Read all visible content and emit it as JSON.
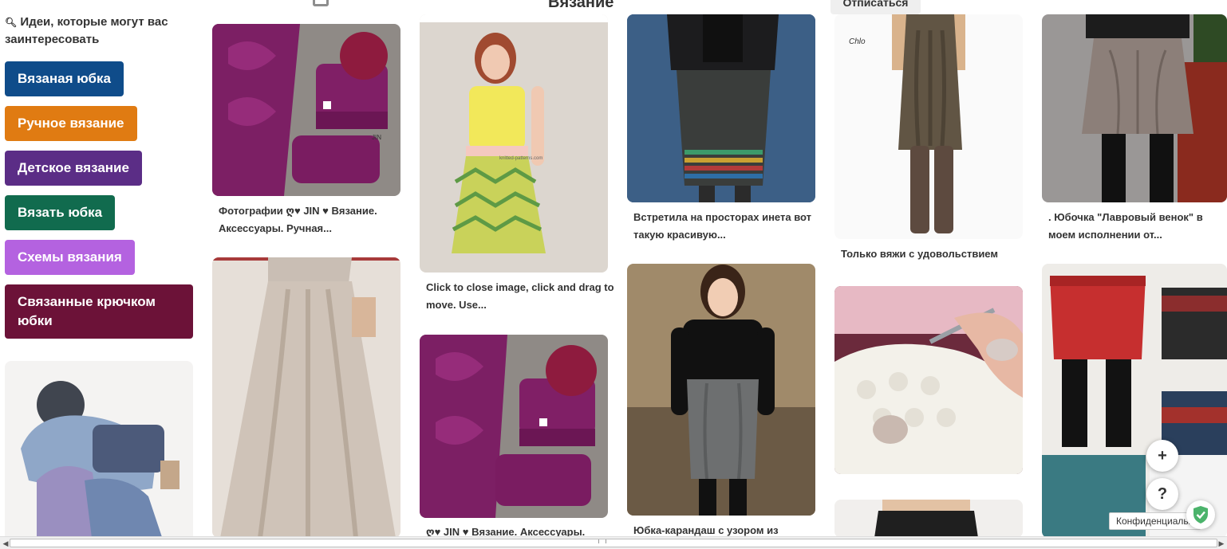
{
  "header": {
    "title": "Вязание",
    "unfollow_label": "Отписаться"
  },
  "sidebar": {
    "ideas_heading": "Идеи, которые могут вас заинтересовать",
    "chips": [
      {
        "label": "Вязаная юбка",
        "color": "#0f4c8a"
      },
      {
        "label": "Ручное вязание",
        "color": "#e07b12"
      },
      {
        "label": "Детское вязание",
        "color": "#5b2d86"
      },
      {
        "label": "Вязать юбка",
        "color": "#116b4e"
      },
      {
        "label": "Схемы вязания",
        "color": "#b462e0"
      },
      {
        "label": "Связанные крючком юбки",
        "color": "#6c1238"
      }
    ]
  },
  "pins": {
    "col1_title1": "Фотографии ღ♥ JIN ♥ Вязание. Аксессуары. Ручная...",
    "col2_title1": "Click to close image, click and drag to move. Use...",
    "col2_title2": "ღ♥ JIN ♥ Вязание. Аксессуары.",
    "col3_title1": "Встретила на просторах инета вот такую красивую...",
    "col3_title2": "Юбка-карандаш с узором из",
    "col4_title1": "Только вяжи с удовольствием",
    "col5_title1": ". Юбочка \"Лавровый венок\" в моем исполнении от..."
  },
  "image_text": {
    "jin_watermark": "JIN",
    "site_watermark": "knitted-patterns.com",
    "brand_label": "Chlo"
  },
  "floating": {
    "plus": "+",
    "help": "?",
    "privacy_label": "Конфиденциальн"
  }
}
